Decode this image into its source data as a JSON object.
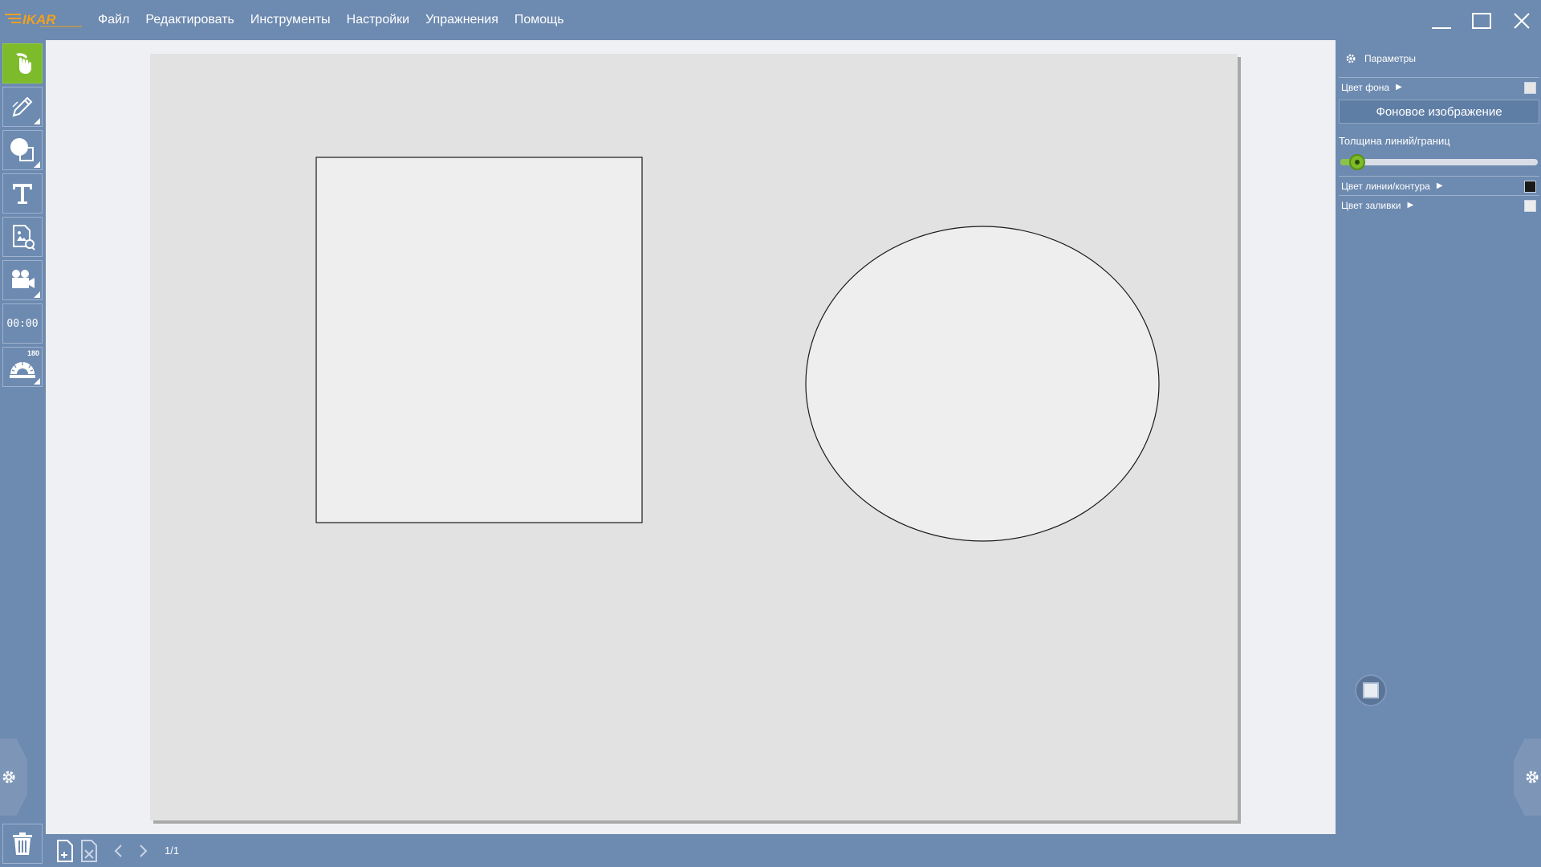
{
  "app": {
    "logo_text": "IKAR",
    "menu": [
      {
        "label": "Файл"
      },
      {
        "label": "Редактировать"
      },
      {
        "label": "Инструменты"
      },
      {
        "label": "Настройки"
      },
      {
        "label": "Упражнения"
      },
      {
        "label": "Помощь"
      }
    ]
  },
  "left_toolbar": {
    "tools": [
      {
        "name": "select-tool",
        "icon": "hand-pointer-icon",
        "active": true
      },
      {
        "name": "pen-tool",
        "icon": "pencil-icon"
      },
      {
        "name": "shapes-tool",
        "icon": "shapes-icon"
      },
      {
        "name": "text-tool",
        "icon": "text-icon"
      },
      {
        "name": "image-tool",
        "icon": "image-file-icon"
      },
      {
        "name": "video-tool",
        "icon": "video-camera-icon"
      },
      {
        "name": "timer-tool",
        "icon": "timer-icon",
        "text": "00:00"
      },
      {
        "name": "protractor-tool",
        "icon": "protractor-icon",
        "badge": "180"
      }
    ]
  },
  "bottom_bar": {
    "page_counter": "1/1"
  },
  "params_panel": {
    "title": "Параметры",
    "bg_color_label": "Цвет фона",
    "bg_color": "#e6e6e6",
    "bg_image_button": "Фоновое изображение",
    "thickness_label": "Толщина линий/границ",
    "thickness_fraction": 0.07,
    "line_color_label": "Цвет линии/контура",
    "line_color": "#1a1a1a",
    "fill_color_label": "Цвет заливки",
    "fill_color": "#ececec"
  },
  "colors": {
    "chrome": "#6d8ab0",
    "accent": "#7dbb2a"
  }
}
